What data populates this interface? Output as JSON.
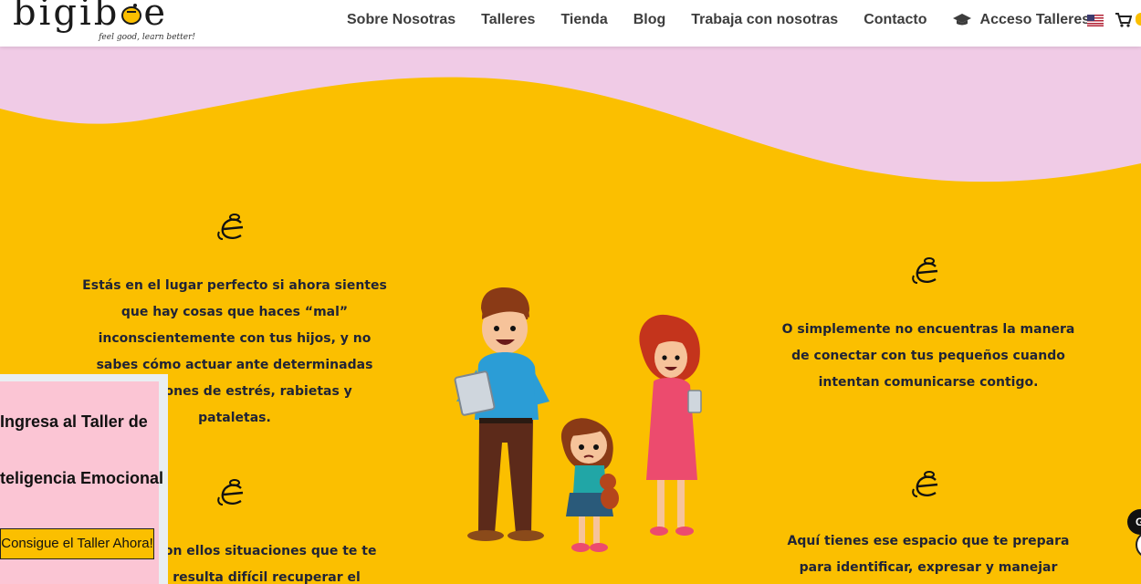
{
  "logo": {
    "name": "bigib",
    "name_end": "e",
    "tagline": "feel good, learn better!"
  },
  "nav": {
    "items": [
      {
        "label": "Sobre Nosotras"
      },
      {
        "label": "Talleres"
      },
      {
        "label": "Tienda"
      },
      {
        "label": "Blog"
      },
      {
        "label": "Trabaja con nosotras"
      },
      {
        "label": "Contacto"
      }
    ],
    "acceso_label": "Acceso Talleres",
    "acceso_icon": "graduation-cap-icon",
    "language_flag": "us-flag-icon",
    "cart_icon": "cart-icon"
  },
  "colors": {
    "background": "#fbbf00",
    "wave": "#f0cbe6",
    "popup": "#fbc5d4",
    "text": "#1f2336"
  },
  "content": {
    "para1": "Estás en el lugar perfecto si ahora sientes que hay cosas que haces “mal” inconscientemente con tus hijos, y no sabes cómo actuar ante determinadas situaciones de estrés, rabietas y pataletas.",
    "para2": "O simplemente no encuentras la manera de conectar con tus pequeños cuando intentan comunicarse contigo.",
    "para3": "Aquí tienes ese espacio que te prepara para identificar, expresar y manejar",
    "para4": "con ellos situaciones que te te resulta difícil recuperar el"
  },
  "popup": {
    "title_line1": "Ingresa al Taller de",
    "title_line2": "teligencia Emocional",
    "button_label": "Consigue el Taller Ahora!"
  },
  "chat": {
    "badge": "G"
  }
}
